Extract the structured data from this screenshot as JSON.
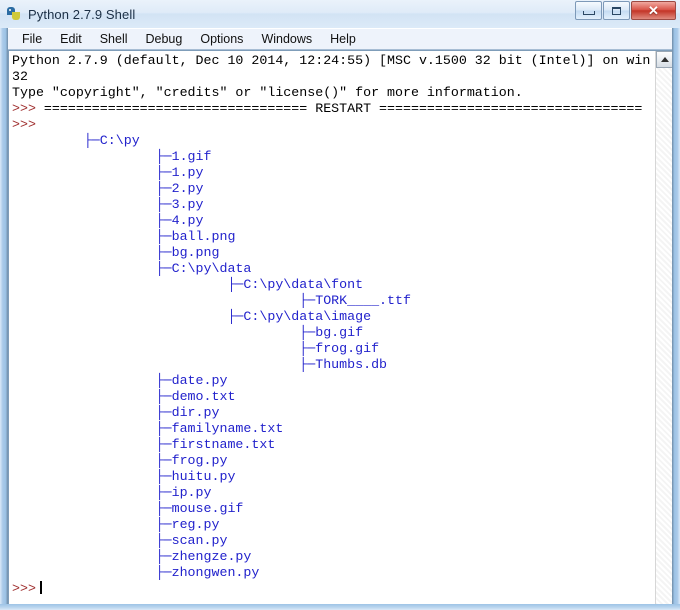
{
  "window": {
    "title": "Python 2.7.9 Shell",
    "icon": "python-logo-icon",
    "buttons": {
      "minimize": "Minimize",
      "maximize": "Maximize",
      "close": "✕"
    }
  },
  "menubar": {
    "items": [
      {
        "label": "File"
      },
      {
        "label": "Edit"
      },
      {
        "label": "Shell"
      },
      {
        "label": "Debug"
      },
      {
        "label": "Options"
      },
      {
        "label": "Windows"
      },
      {
        "label": "Help"
      }
    ]
  },
  "console": {
    "banner_line1": "Python 2.7.9 (default, Dec 10 2014, 12:24:55) [MSC v.1500 32 bit (Intel)] on win",
    "banner_line2": "32",
    "banner_line3": "Type \"copyright\", \"credits\" or \"license()\" for more information.",
    "prompt": ">>> ",
    "restart_line": "================================= RESTART =================================",
    "blank_prompt": ">>>",
    "final_prompt": ">>>",
    "tree": [
      {
        "indent": 9,
        "text": "├─C:\\py"
      },
      {
        "indent": 18,
        "text": "├─1.gif"
      },
      {
        "indent": 18,
        "text": "├─1.py"
      },
      {
        "indent": 18,
        "text": "├─2.py"
      },
      {
        "indent": 18,
        "text": "├─3.py"
      },
      {
        "indent": 18,
        "text": "├─4.py"
      },
      {
        "indent": 18,
        "text": "├─ball.png"
      },
      {
        "indent": 18,
        "text": "├─bg.png"
      },
      {
        "indent": 18,
        "text": "├─C:\\py\\data"
      },
      {
        "indent": 27,
        "text": "├─C:\\py\\data\\font"
      },
      {
        "indent": 36,
        "text": "├─TORK____.ttf"
      },
      {
        "indent": 27,
        "text": "├─C:\\py\\data\\image"
      },
      {
        "indent": 36,
        "text": "├─bg.gif"
      },
      {
        "indent": 36,
        "text": "├─frog.gif"
      },
      {
        "indent": 36,
        "text": "├─Thumbs.db"
      },
      {
        "indent": 18,
        "text": "├─date.py"
      },
      {
        "indent": 18,
        "text": "├─demo.txt"
      },
      {
        "indent": 18,
        "text": "├─dir.py"
      },
      {
        "indent": 18,
        "text": "├─familyname.txt"
      },
      {
        "indent": 18,
        "text": "├─firstname.txt"
      },
      {
        "indent": 18,
        "text": "├─frog.py"
      },
      {
        "indent": 18,
        "text": "├─huitu.py"
      },
      {
        "indent": 18,
        "text": "├─ip.py"
      },
      {
        "indent": 18,
        "text": "├─mouse.gif"
      },
      {
        "indent": 18,
        "text": "├─reg.py"
      },
      {
        "indent": 18,
        "text": "├─scan.py"
      },
      {
        "indent": 18,
        "text": "├─zhengze.py"
      },
      {
        "indent": 18,
        "text": "├─zhongwen.py"
      }
    ]
  },
  "scrollbar": {
    "up_arrow": "scroll-up-arrow"
  },
  "colors": {
    "prompt": "#a03030",
    "output_text": "#2222cc",
    "stdout_text": "#000000",
    "close_button": "#c33527",
    "titlebar": "#d2e3f4"
  }
}
